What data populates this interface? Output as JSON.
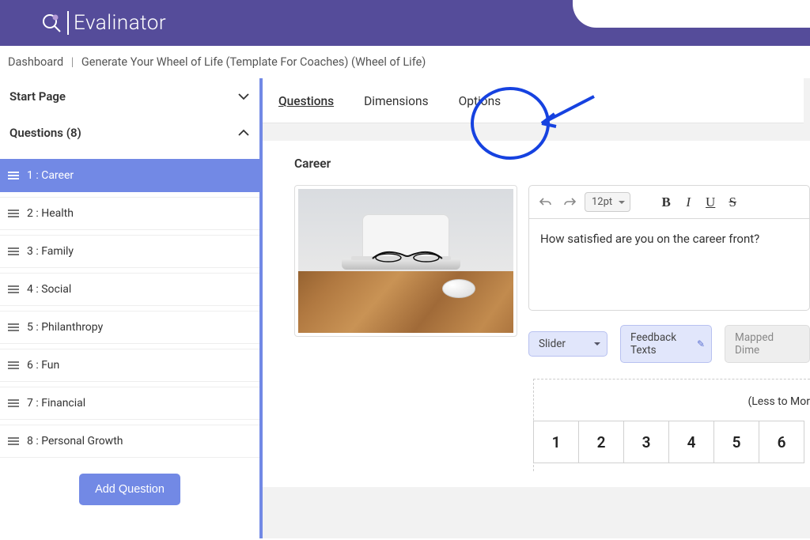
{
  "logo": {
    "text": "Evalinator"
  },
  "breadcrumb": {
    "dashboard": "Dashboard",
    "current": "Generate Your Wheel of Life (Template For Coaches) (Wheel of Life)"
  },
  "sidebar": {
    "startPage": "Start Page",
    "questionsHeader": "Questions (8)",
    "items": [
      "1 : Career",
      "2 : Health",
      "3 : Family",
      "4 : Social",
      "5 : Philanthropy",
      "6 : Fun",
      "7 : Financial",
      "8 : Personal Growth"
    ],
    "addButton": "Add Question"
  },
  "tabs": {
    "questions": "Questions",
    "dimensions": "Dimensions",
    "options": "Options"
  },
  "editor": {
    "title": "Career",
    "fontSize": "12pt",
    "body": "How satisfied are you on the career front?",
    "sliderChip": "Slider",
    "feedbackChip": "Feedback Texts",
    "mappedChip": "Mapped Dime",
    "scaleLabel": "(Less to Mor",
    "scale": [
      "1",
      "2",
      "3",
      "4",
      "5",
      "6"
    ]
  }
}
